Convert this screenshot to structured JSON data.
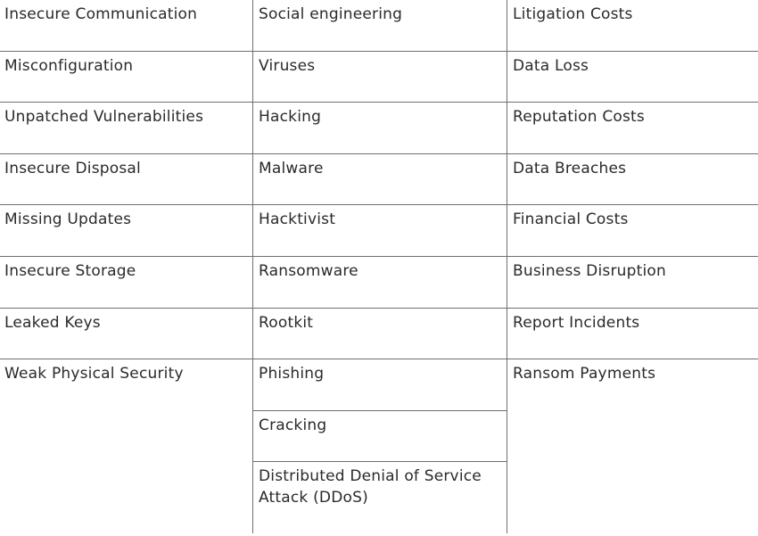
{
  "table": {
    "columns": [
      {
        "cells": [
          "Insecure Communication",
          "Misconfiguration",
          "Unpatched Vulnerabilities",
          "Insecure Disposal",
          "Missing Updates",
          "Insecure Storage",
          "Leaked Keys",
          "Weak Physical Security"
        ]
      },
      {
        "cells": [
          "Social engineering",
          "Viruses",
          "Hacking",
          "Malware",
          "Hacktivist",
          "Ransomware",
          "Rootkit",
          "Phishing",
          "Cracking",
          "Distributed Denial of Service Attack (DDoS)"
        ]
      },
      {
        "cells": [
          "Litigation Costs",
          "Data Loss",
          "Reputation Costs",
          "Data Breaches",
          "Financial Costs",
          "Business Disruption",
          "Report Incidents",
          "Ransom Payments"
        ]
      }
    ]
  }
}
